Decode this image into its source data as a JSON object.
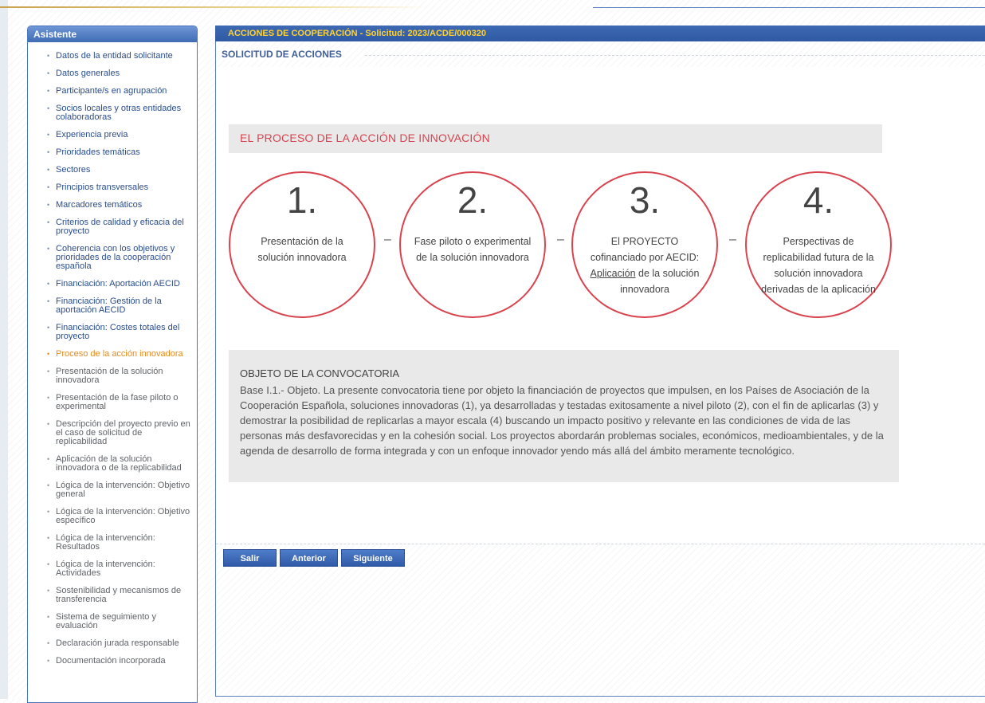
{
  "sidebar": {
    "title": "Asistente",
    "items": [
      {
        "label": "Datos de la entidad solicitante"
      },
      {
        "label": "Datos generales"
      },
      {
        "label": "Participante/s en agrupación"
      },
      {
        "label": "Socios locales y otras entidades colaboradoras"
      },
      {
        "label": "Experiencia previa"
      },
      {
        "label": "Prioridades temáticas"
      },
      {
        "label": "Sectores"
      },
      {
        "label": "Principios transversales"
      },
      {
        "label": "Marcadores temáticos"
      },
      {
        "label": "Criterios de calidad y eficacia del proyecto"
      },
      {
        "label": "Coherencia con los objetivos y prioridades de la cooperación española"
      },
      {
        "label": "Financiación: Aportación AECID"
      },
      {
        "label": "Financiación: Gestión de la aportación AECID"
      },
      {
        "label": "Financiación: Costes totales del proyecto"
      },
      {
        "label": "Proceso de la acción innovadora"
      },
      {
        "label": "Presentación de la solución innovadora"
      },
      {
        "label": "Presentación de la fase piloto o experimental"
      },
      {
        "label": "Descripción del proyecto previo en el caso de solicitud de replicabilidad"
      },
      {
        "label": "Aplicación de la solución innovadora o de la replicabilidad"
      },
      {
        "label": "Lógica de la intervención: Objetivo general"
      },
      {
        "label": "Lógica de la intervención: Objetivo específico"
      },
      {
        "label": "Lógica de la intervención: Resultados"
      },
      {
        "label": "Lógica de la intervención: Actividades"
      },
      {
        "label": "Sostenibilidad y mecanismos de transferencia"
      },
      {
        "label": "Sistema de seguimiento y evaluación"
      },
      {
        "label": "Declaración jurada responsable"
      },
      {
        "label": "Documentación incorporada"
      }
    ]
  },
  "header": {
    "title": "ACCIONES DE COOPERACIÓN - Solicitud: 2023/ACDE/000320"
  },
  "section": {
    "legend": "SOLICITUD DE ACCIONES"
  },
  "banner": {
    "title": "EL PROCESO DE LA ACCIÓN DE INNOVACIÓN"
  },
  "steps": [
    {
      "number": "1.",
      "text": "Presentación de la solución innovadora"
    },
    {
      "number": "2.",
      "text": "Fase piloto o experimental de la solución innovadora"
    },
    {
      "number": "3.",
      "line1": "El PROYECTO",
      "line2": "cofinanciado por AECID:",
      "link": "Aplicación",
      "line3": " de la solución",
      "line4": "innovadora"
    },
    {
      "number": "4.",
      "text": "Perspectivas de replicabilidad futura de la solución innovadora derivadas de la aplicación"
    }
  ],
  "separator": "–",
  "objeto": {
    "title": "OBJETO DE LA CONVOCATORIA",
    "text": "Base I.1.- Objeto. La presente convocatoria tiene por objeto la financiación de proyectos que impulsen, en los Países de Asociación de la Cooperación Española, soluciones innovadoras (1), ya desarrolladas y testadas exitosamente a nivel piloto (2), con el fin de aplicarlas (3) y demostrar la posibilidad de replicarlas a mayor escala (4) buscando un impacto positivo y relevante en las condiciones de vida de las personas más desfavorecidas y en la cohesión social. Los proyectos abordarán problemas sociales, económicos, medioambientales, y de la agenda de desarrollo de forma integrada y con un enfoque innovador yendo más allá del ámbito meramente tecnológico."
  },
  "buttons": {
    "salir": "Salir",
    "anterior": "Anterior",
    "siguiente": "Siguiente"
  },
  "colors": {
    "accent_blue": "#3e69b3",
    "header_text": "#ffd232",
    "active_item": "#e88a1a",
    "circle_red": "#d9434e"
  }
}
